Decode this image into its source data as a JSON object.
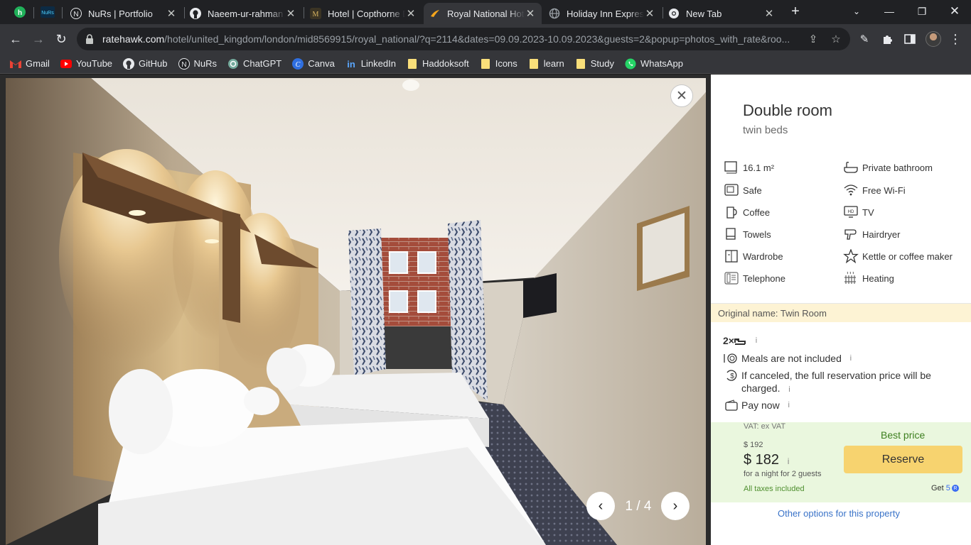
{
  "browser": {
    "tabs": [
      {
        "title": "NuRs | Portfolio",
        "active": false
      },
      {
        "title": "Naeem-ur-rahman (",
        "active": false
      },
      {
        "title": "Hotel | Copthorne D",
        "active": false
      },
      {
        "title": "Royal National Hote",
        "active": true
      },
      {
        "title": "Holiday Inn Express",
        "active": false
      },
      {
        "title": "New Tab",
        "active": false
      }
    ],
    "url_host": "ratehawk.com",
    "url_path": "/hotel/united_kingdom/london/mid8569915/royal_national/?q=2114&dates=09.09.2023-10.09.2023&guests=2&popup=photos_with_rate&roo...",
    "bookmarks": [
      "Gmail",
      "YouTube",
      "GitHub",
      "NuRs",
      "ChatGPT",
      "Canva",
      "LinkedIn",
      "Haddoksoft",
      "Icons",
      "learn",
      "Study",
      "WhatsApp"
    ]
  },
  "gallery": {
    "counter": "1 / 4"
  },
  "room": {
    "title": "Double room",
    "subtitle": "twin beds",
    "amenities_left": [
      {
        "label": "16.1 m²",
        "icon": "area-icon"
      },
      {
        "label": "Safe",
        "icon": "safe-icon"
      },
      {
        "label": "Coffee",
        "icon": "coffee-icon"
      },
      {
        "label": "Towels",
        "icon": "towels-icon"
      },
      {
        "label": "Wardrobe",
        "icon": "wardrobe-icon"
      },
      {
        "label": "Telephone",
        "icon": "telephone-icon"
      }
    ],
    "amenities_right": [
      {
        "label": "Private bathroom",
        "icon": "bathtub-icon"
      },
      {
        "label": "Free Wi-Fi",
        "icon": "wifi-icon"
      },
      {
        "label": "TV",
        "icon": "tv-icon"
      },
      {
        "label": "Hairdryer",
        "icon": "hairdryer-icon"
      },
      {
        "label": "Kettle or coffee maker",
        "icon": "star-icon"
      },
      {
        "label": "Heating",
        "icon": "heating-icon"
      }
    ],
    "original_name": "Original name: Twin Room",
    "beds": "2×",
    "meals": "Meals are not included",
    "cancellation": "If canceled, the full reservation price will be charged.",
    "payment": "Pay now"
  },
  "pricing": {
    "vat": "VAT: ex VAT",
    "old_price": "$ 192",
    "price": "$ 182",
    "per_night": "for a night for 2 guests",
    "taxes": "All taxes included",
    "best_price": "Best price",
    "reserve": "Reserve",
    "points_label": "Get",
    "points": "5"
  },
  "other_options": "Other options for this property",
  "colors": {
    "reserve": "#f7d36f",
    "price_bg": "#eaf7de",
    "best_price": "#3d7f1f",
    "link": "#3a73c8"
  }
}
